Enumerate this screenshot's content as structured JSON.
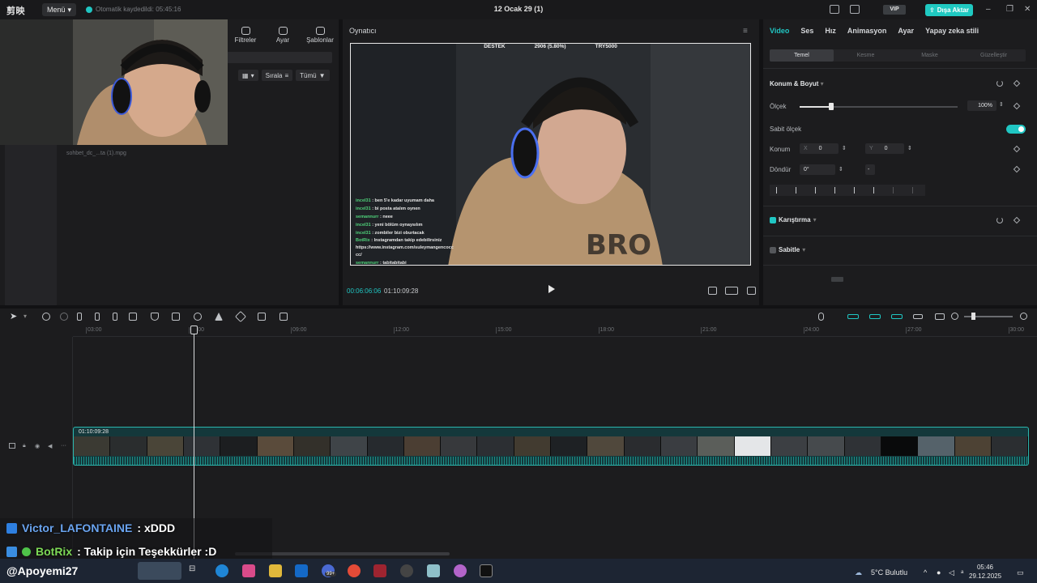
{
  "titlebar": {
    "logo": "剪映",
    "menu_label": "Menü",
    "autosave": "Otomatik kaydedildi: 05:45:16",
    "project_title": "12 Ocak 29 (1)",
    "vip_label": "VIP",
    "export_label": "Dışa Aktar"
  },
  "media_panel": {
    "tabs": [
      {
        "label": "Filtreler",
        "icon": "filter-icon"
      },
      {
        "label": "Ayar",
        "icon": "adjust-icon"
      },
      {
        "label": "Şablonlar",
        "icon": "template-icon"
      }
    ],
    "sort_label": "Sırala",
    "filter_label": "Tümü",
    "file_name": "sohbet_dc_...ta (1).mpg"
  },
  "player": {
    "title": "Oynatıcı",
    "current_time": "00:06:06:06",
    "total_time": "01:10:09:28",
    "stream_bar": [
      "DESTEK",
      "2906 (5.80%)",
      "TRY5000"
    ],
    "chat": [
      {
        "user": "incel31",
        "text": ": ben 5'e kadar uyumam daha"
      },
      {
        "user": "incel31",
        "text": ": bi posta atalım oynen"
      },
      {
        "user": "semannurr",
        "text": ": neee"
      },
      {
        "user": "incel31",
        "text": ": yeni bölüm oynaysılım"
      },
      {
        "user": "incel31",
        "text": ": zombiler bizi oburtacak"
      },
      {
        "user": "BotRix",
        "text": ": Instagramdan takip edebilirsiniz https://www.instagram.com/suleymangencocc cc/"
      },
      {
        "user": "semannurr",
        "text": ": tabitabitabi"
      }
    ]
  },
  "props": {
    "tabs": [
      "Video",
      "Ses",
      "Hız",
      "Animasyon",
      "Ayar",
      "Yapay zeka stili"
    ],
    "active_tab": "Video",
    "subtabs": [
      "Temel",
      "Kesme",
      "Maske",
      "Güzelleştir"
    ],
    "position_section": "Konum & Boyut",
    "scale_label": "Ölçek",
    "scale_value": "100%",
    "scale_fraction": 0.2,
    "uniform_scale_label": "Sabit ölçek",
    "position_label": "Konum",
    "pos_x_label": "X",
    "pos_x": "0",
    "pos_y_label": "Y",
    "pos_y": "0",
    "rotate_label": "Döndür",
    "rotate_value": "0°",
    "blend_section": "Karıştırma",
    "stabilize_section": "Sabitle"
  },
  "timeline": {
    "ticks": [
      "03:00",
      "06:00",
      "09:00",
      "12:00",
      "15:00",
      "18:00",
      "21:00",
      "24:00",
      "27:00",
      "30:00"
    ],
    "clip_duration": "01:10:09:28"
  },
  "overlay_chat": [
    {
      "user": "Victor_LAFONTAINE",
      "text": ": xDDD"
    },
    {
      "user": "BotRix",
      "text": ": Takip için Teşekkürler :D"
    }
  ],
  "stream_handle": "@Apoyemi27",
  "taskbar": {
    "weather": "5°C Bulutlu",
    "time": "05:46",
    "date": "29.12.2025",
    "badge": "99+"
  },
  "colors": {
    "accent": "#20c6c3",
    "panel": "#1c1c1e",
    "background": "#121214",
    "clip": "#14383b"
  }
}
